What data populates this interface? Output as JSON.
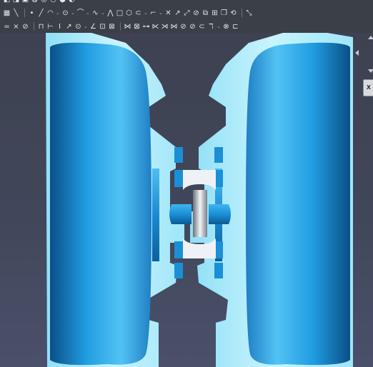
{
  "toolbar": {
    "row0": [
      {
        "icon": "sketch-icon",
        "glyph": "◧"
      },
      {
        "icon": "pad-icon",
        "glyph": "◨"
      },
      {
        "icon": "pocket-icon",
        "glyph": "▣"
      },
      {
        "icon": "revolve-icon",
        "glyph": "◍"
      },
      {
        "icon": "groove-icon",
        "glyph": "◎"
      },
      {
        "icon": "fillet-icon",
        "glyph": "◔"
      },
      {
        "icon": "chamfer-icon",
        "glyph": "◕"
      },
      {
        "icon": "mirror-icon",
        "glyph": "◐"
      }
    ],
    "row1": [
      {
        "icon": "view-sketch-icon",
        "glyph": "▦"
      },
      {
        "icon": "leave-sketch-icon",
        "glyph": "╲"
      },
      {
        "sep": true
      },
      {
        "icon": "point-icon",
        "glyph": "•"
      },
      {
        "icon": "line-icon",
        "glyph": "╱"
      },
      {
        "icon": "arc-icon",
        "glyph": "◠"
      },
      {
        "drop": true
      },
      {
        "icon": "circle-icon",
        "glyph": "⊙"
      },
      {
        "drop": true
      },
      {
        "icon": "conic-icon",
        "glyph": "⌒"
      },
      {
        "drop": true
      },
      {
        "icon": "bspline-icon",
        "glyph": "∿"
      },
      {
        "drop": true
      },
      {
        "icon": "polyline-icon",
        "glyph": "⋀"
      },
      {
        "icon": "rectangle-icon",
        "glyph": "□"
      },
      {
        "icon": "polygon-icon",
        "glyph": "⬡"
      },
      {
        "icon": "slot-icon",
        "glyph": "⊂"
      },
      {
        "drop": true
      },
      {
        "icon": "fillet-sketch-icon",
        "glyph": "⌐"
      },
      {
        "drop": true
      },
      {
        "icon": "trim-icon",
        "glyph": "✕"
      },
      {
        "icon": "extend-icon",
        "glyph": "↗"
      },
      {
        "icon": "split-icon",
        "glyph": "⤢"
      },
      {
        "icon": "external-geometry-icon",
        "glyph": "⊘"
      },
      {
        "icon": "carbon-copy-icon",
        "glyph": "⧉"
      },
      {
        "icon": "construction-mode-icon",
        "glyph": "⊞"
      },
      {
        "icon": "clone-icon",
        "glyph": "❐"
      },
      {
        "icon": "move-icon",
        "glyph": "⟲"
      },
      {
        "sep": true
      },
      {
        "icon": "toggle-construction-icon",
        "glyph": "⤡"
      }
    ],
    "row2": [
      {
        "icon": "coincident-constraint-icon",
        "glyph": "="
      },
      {
        "icon": "point-on-object-icon",
        "glyph": "×"
      },
      {
        "icon": "vertical-constraint-icon",
        "glyph": "⊘"
      },
      {
        "sep": true
      },
      {
        "icon": "lock-constraint-icon",
        "glyph": "⊓"
      },
      {
        "icon": "horizontal-distance-icon",
        "glyph": "⊢"
      },
      {
        "icon": "vertical-distance-icon",
        "glyph": "I"
      },
      {
        "icon": "distance-constraint-icon",
        "glyph": "↗"
      },
      {
        "icon": "radius-constraint-icon",
        "glyph": "⊙"
      },
      {
        "drop": true
      },
      {
        "icon": "angle-constraint-icon",
        "glyph": "∠"
      },
      {
        "icon": "toggle-driving-icon",
        "glyph": "⊡"
      },
      {
        "icon": "reference-constraint-icon",
        "glyph": "⊠"
      },
      {
        "sep": true
      },
      {
        "icon": "select-constraints-icon",
        "glyph": "⋈"
      },
      {
        "icon": "select-origin-icon",
        "glyph": "⊠"
      },
      {
        "icon": "select-axis-icon",
        "glyph": "⊶"
      },
      {
        "icon": "select-elements-icon",
        "glyph": "⋉"
      },
      {
        "icon": "select-conflicting-icon",
        "glyph": "⋊"
      },
      {
        "icon": "select-redundant-icon",
        "glyph": "⋈"
      },
      {
        "icon": "show-hide-icon",
        "glyph": "⊘"
      },
      {
        "icon": "validate-sketch-icon",
        "glyph": "⊘"
      },
      {
        "icon": "merge-sketch-icon",
        "glyph": "⊂"
      },
      {
        "icon": "mirror-sketch-icon",
        "glyph": "ℸ"
      },
      {
        "drop": true
      },
      {
        "icon": "restore-view-icon",
        "glyph": "⊗"
      },
      {
        "icon": "section-view-icon",
        "glyph": "⊏"
      }
    ]
  },
  "nav_cube": {
    "face_label": "X",
    "face_icon": "nav-cube-icon"
  },
  "colors": {
    "part_light": "#bfeefa",
    "part_blue": "#1a9be0",
    "part_dark": "#0a4f86",
    "background": "#3d4151"
  }
}
